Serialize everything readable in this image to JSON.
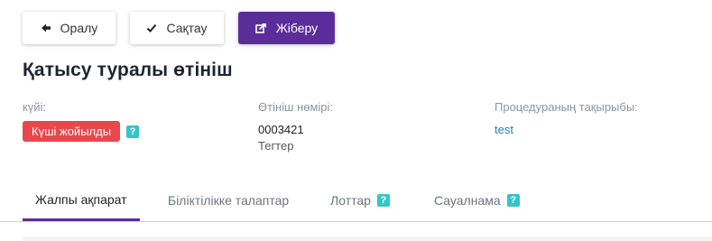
{
  "toolbar": {
    "back_label": "Оралу",
    "save_label": "Сақтау",
    "send_label": "Жіберу"
  },
  "page_title": "Қатысу туралы өтініш",
  "fields": {
    "status": {
      "label": "күйі:",
      "value": "Күші жойылды"
    },
    "number": {
      "label": "Өтініш нөмірі:",
      "value": "0003421",
      "sub": "Тегтер"
    },
    "topic": {
      "label": "Процедураның тақырыбы:",
      "value": "test"
    }
  },
  "help_mark": "?",
  "tabs": [
    {
      "label": "Жалпы ақпарат",
      "active": true
    },
    {
      "label": "Біліктілікке талаптар"
    },
    {
      "label": "Лоттар",
      "help": true
    },
    {
      "label": "Сауалнама",
      "help": true
    }
  ],
  "colors": {
    "accent": "#5b2d9b",
    "status_cancelled": "#e8474b",
    "help_badge": "#37c4c9",
    "link": "#2b79c2"
  },
  "icons": {
    "back": "arrow-left-icon",
    "save": "check-icon",
    "send": "share-icon"
  }
}
